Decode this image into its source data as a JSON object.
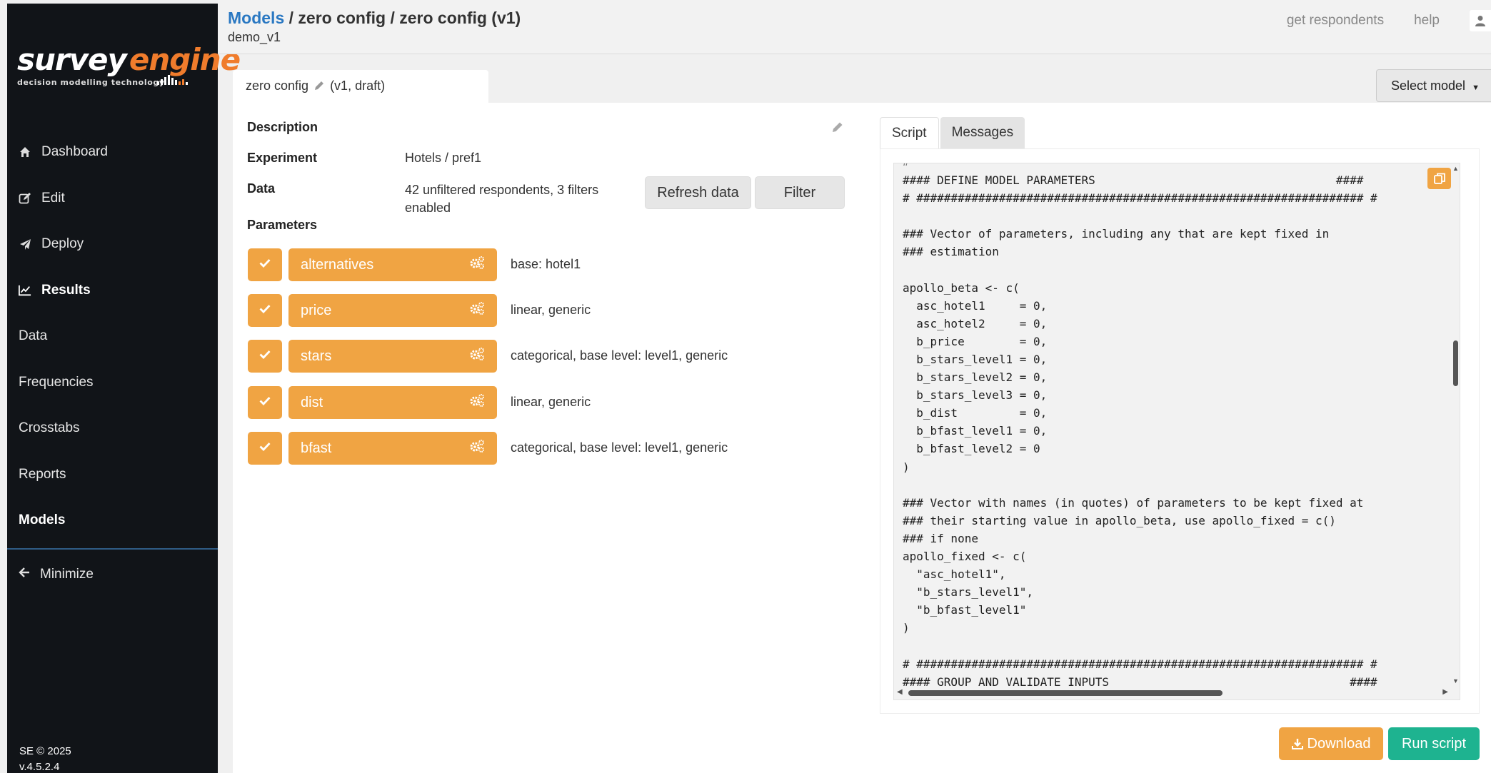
{
  "sidebar": {
    "logo_word_1": "survey",
    "logo_word_2": "engine",
    "logo_tagline": "decision modelling technology",
    "items": [
      {
        "label": "Dashboard",
        "icon": "home-icon"
      },
      {
        "label": "Edit",
        "icon": "edit-icon"
      },
      {
        "label": "Deploy",
        "icon": "paper-plane-icon"
      },
      {
        "label": "Results",
        "icon": "line-chart-icon"
      },
      {
        "label": "Data"
      },
      {
        "label": "Frequencies"
      },
      {
        "label": "Crosstabs"
      },
      {
        "label": "Reports"
      },
      {
        "label": "Models"
      }
    ],
    "minimize_label": "Minimize",
    "footer_copyright": "SE © 2025",
    "footer_version": "v.4.5.2.4"
  },
  "header": {
    "breadcrumb_link": "Models",
    "breadcrumb_rest": " / zero config / zero config (v1)",
    "subtitle": "demo_v1",
    "link_respondents": "get respondents",
    "link_help": "help"
  },
  "model": {
    "tab_name": "zero config",
    "tab_status": "(v1, draft)",
    "select_model_label": "Select model",
    "description_label": "Description",
    "experiment_label": "Experiment",
    "experiment_value": "Hotels / pref1",
    "data_label": "Data",
    "data_value": "42 unfiltered respondents, 3 filters enabled",
    "refresh_label": "Refresh data",
    "filter_label": "Filter",
    "parameters_label": "Parameters",
    "parameters": [
      {
        "name": "alternatives",
        "desc": "base: hotel1",
        "checked": true
      },
      {
        "name": "price",
        "desc": "linear, generic",
        "checked": true
      },
      {
        "name": "stars",
        "desc": "categorical, base level: level1, generic",
        "checked": true
      },
      {
        "name": "dist",
        "desc": "linear, generic",
        "checked": true
      },
      {
        "name": "bfast",
        "desc": "categorical, base level: level1, generic",
        "checked": true
      }
    ]
  },
  "script": {
    "tab_script": "Script",
    "tab_messages": "Messages",
    "code": "#### DEFINE MODEL PARAMETERS                                   ####\n# ################################################################# #\n\n### Vector of parameters, including any that are kept fixed in\n### estimation\n\napollo_beta <- c(\n  asc_hotel1     = 0,\n  asc_hotel2     = 0,\n  b_price        = 0,\n  b_stars_level1 = 0,\n  b_stars_level2 = 0,\n  b_stars_level3 = 0,\n  b_dist         = 0,\n  b_bfast_level1 = 0,\n  b_bfast_level2 = 0\n)\n\n### Vector with names (in quotes) of parameters to be kept fixed at\n### their starting value in apollo_beta, use apollo_fixed = c()\n### if none\napollo_fixed <- c(\n  \"asc_hotel1\",\n  \"b_stars_level1\",\n  \"b_bfast_level1\"\n)\n\n# ################################################################# #\n#### GROUP AND VALIDATE INPUTS                                   ####",
    "download_label": "Download",
    "run_label": "Run script"
  },
  "colors": {
    "accent_orange": "#f0a443",
    "brand_blue": "#2a78c2",
    "run_green": "#1eb390",
    "sidebar_bg": "#111418"
  }
}
